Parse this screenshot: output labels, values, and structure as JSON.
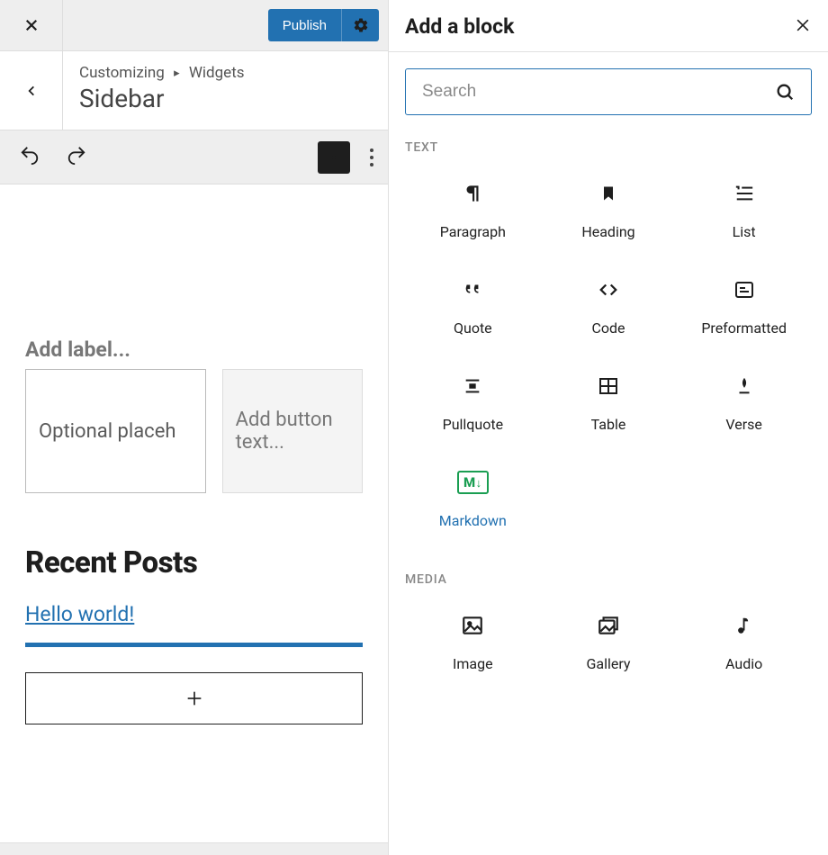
{
  "topbar": {
    "publish_label": "Publish"
  },
  "breadcrumb": {
    "root": "Customizing",
    "child": "Widgets",
    "title": "Sidebar"
  },
  "editor": {
    "label_placeholder": "Add label...",
    "optional_placeholder": "Optional placeh",
    "button_placeholder": "Add button text...",
    "heading": "Recent Posts",
    "link_text": "Hello world!"
  },
  "inserter": {
    "title": "Add a block",
    "search_placeholder": "Search",
    "cat_text": "TEXT",
    "cat_media": "MEDIA",
    "blocks_text": [
      {
        "id": "paragraph",
        "label": "Paragraph"
      },
      {
        "id": "heading",
        "label": "Heading"
      },
      {
        "id": "list",
        "label": "List"
      },
      {
        "id": "quote",
        "label": "Quote"
      },
      {
        "id": "code",
        "label": "Code"
      },
      {
        "id": "preformatted",
        "label": "Preformatted"
      },
      {
        "id": "pullquote",
        "label": "Pullquote"
      },
      {
        "id": "table",
        "label": "Table"
      },
      {
        "id": "verse",
        "label": "Verse"
      },
      {
        "id": "markdown",
        "label": "Markdown",
        "selected": true
      }
    ],
    "blocks_media": [
      {
        "id": "image",
        "label": "Image"
      },
      {
        "id": "gallery",
        "label": "Gallery"
      },
      {
        "id": "audio",
        "label": "Audio"
      }
    ]
  }
}
